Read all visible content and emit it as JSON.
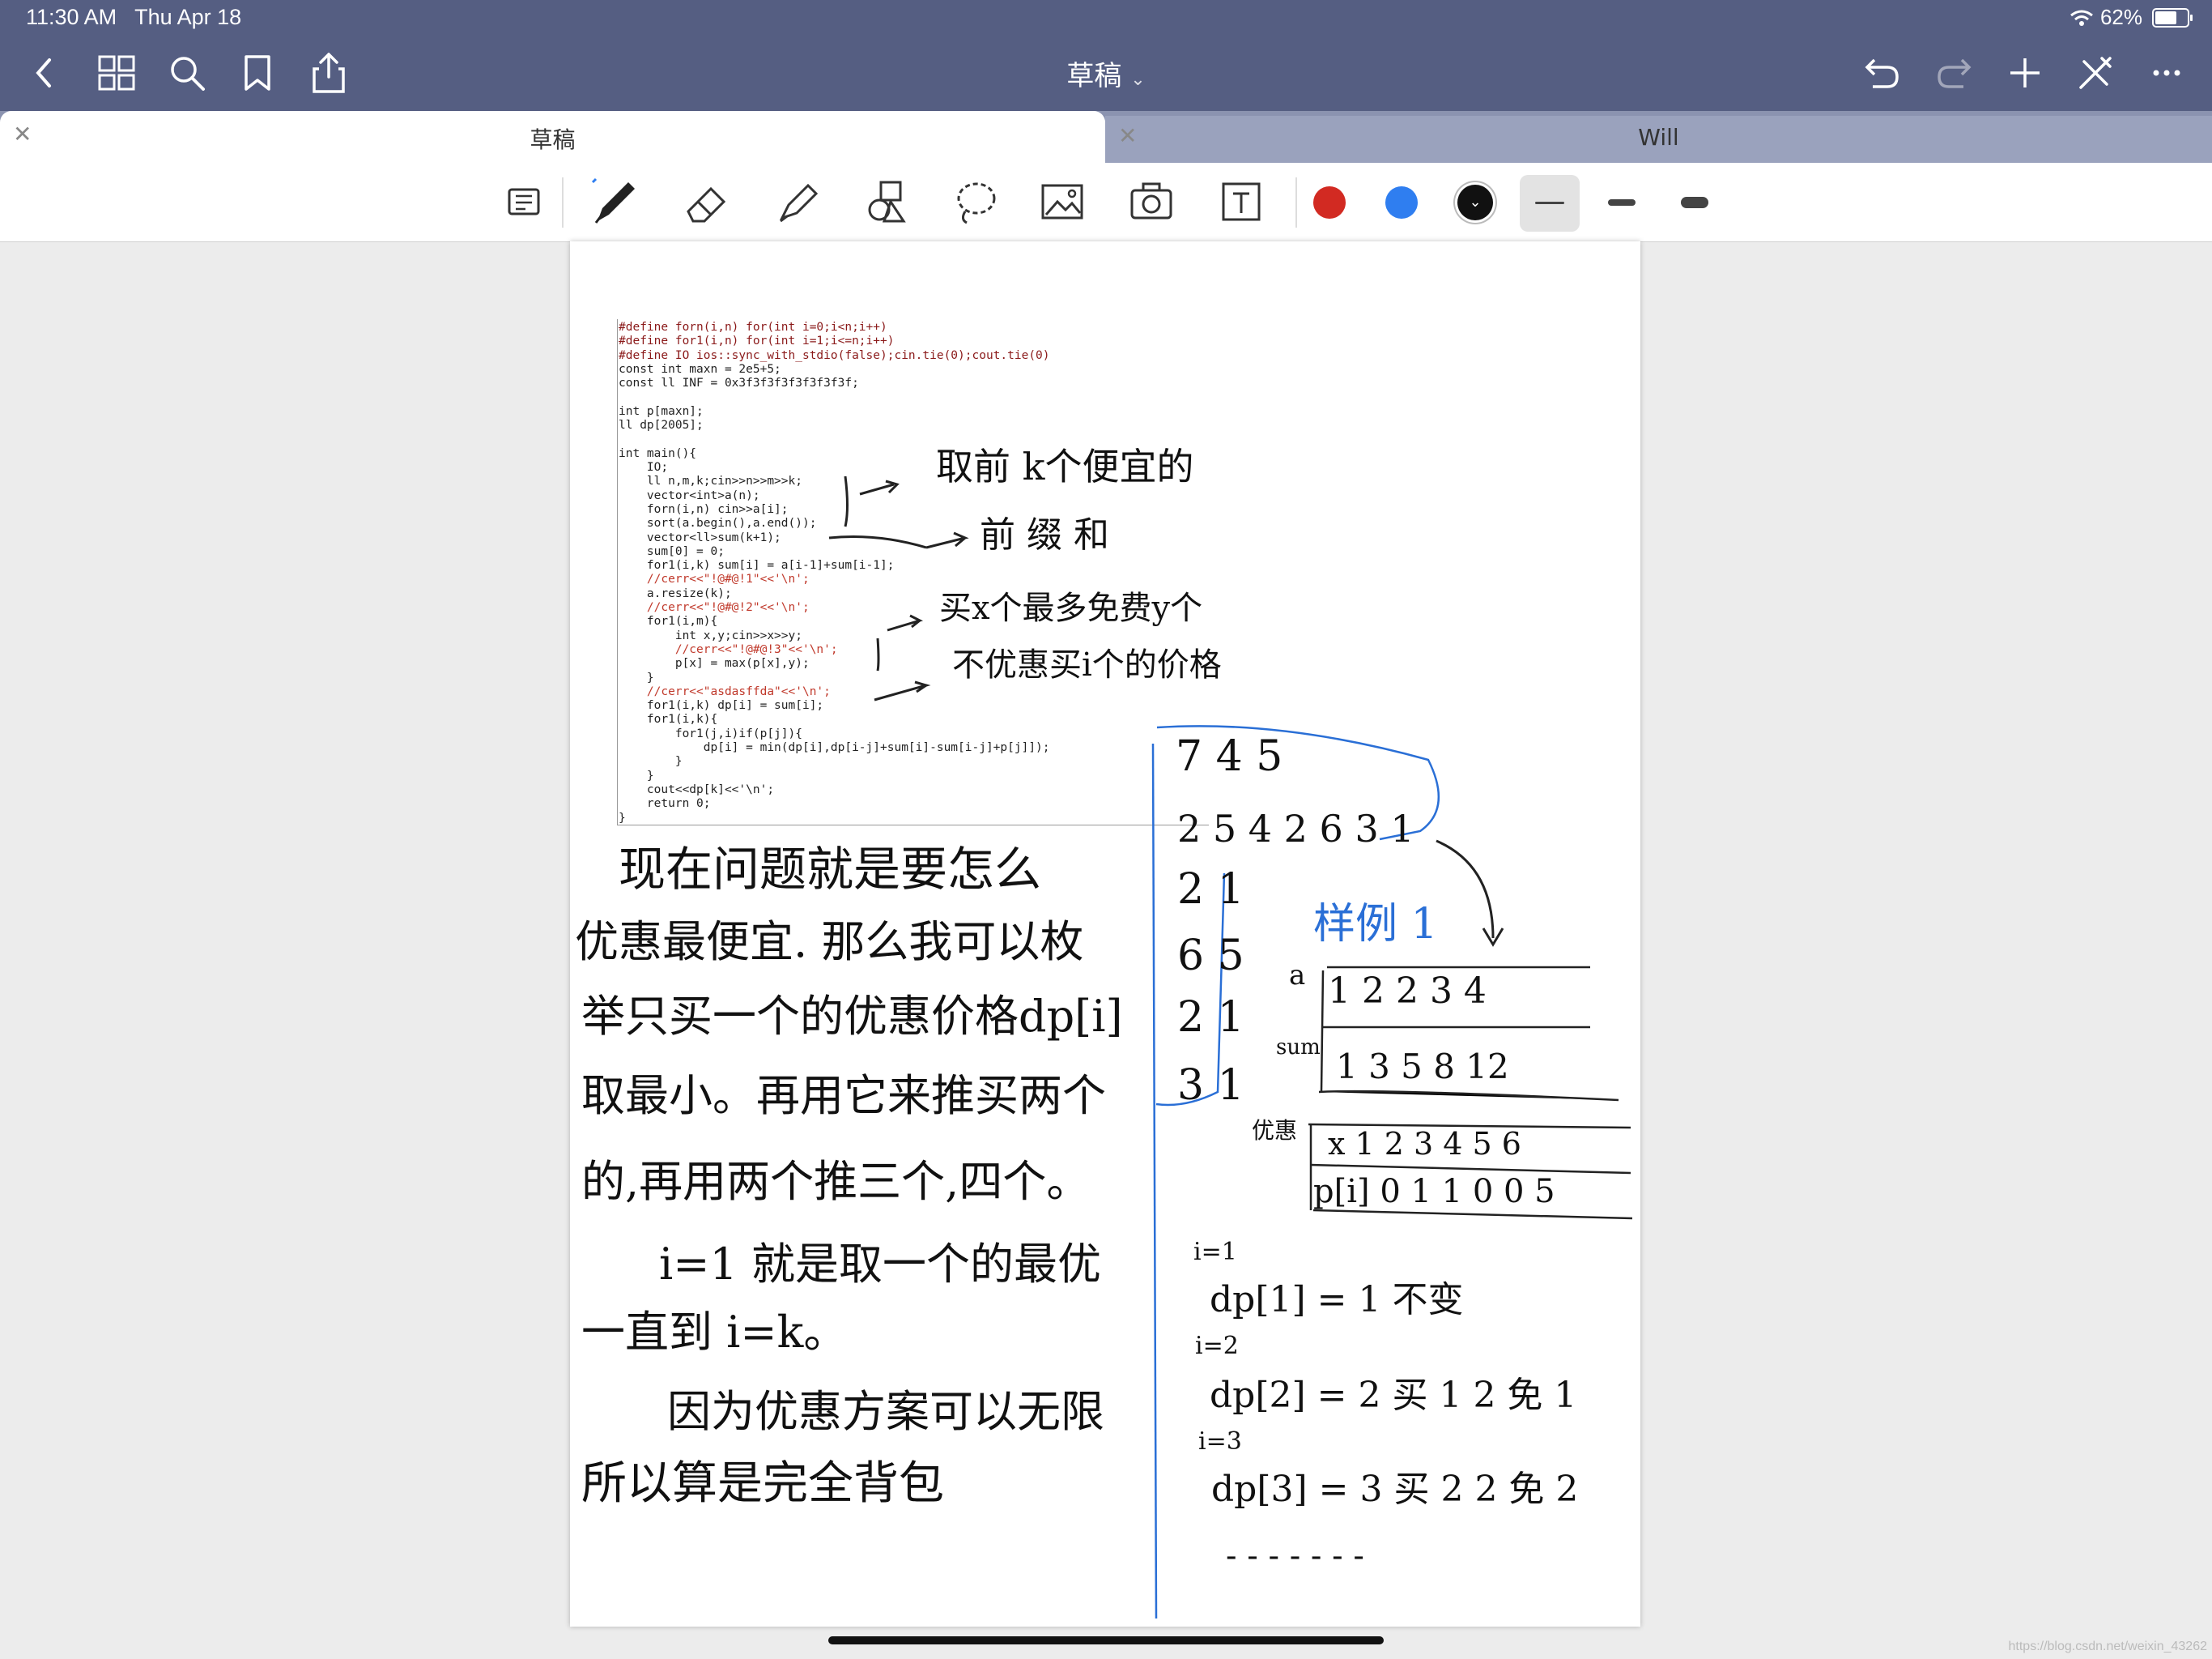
{
  "status": {
    "time": "11:30 AM",
    "date": "Thu Apr 18",
    "battery": "62%"
  },
  "nav": {
    "title": "草稿"
  },
  "tabs": [
    {
      "label": "草稿"
    },
    {
      "label": "Will"
    }
  ],
  "colors": {
    "red": "#d22a22",
    "blue": "#2f7ef0",
    "black": "#111111",
    "bar": "#555e82"
  },
  "code": [
    "#define forn(i,n) for(int i=0;i<n;i++)",
    "#define for1(i,n) for(int i=1;i<=n;i++)",
    "#define IO ios::sync_with_stdio(false);cin.tie(0);cout.tie(0)",
    "const int maxn = 2e5+5;",
    "const ll INF = 0x3f3f3f3f3f3f3f3f;",
    "",
    "int p[maxn];",
    "ll dp[2005];",
    "",
    "int main(){",
    "    IO;",
    "    ll n,m,k;cin>>n>>m>>k;",
    "    vector<int>a(n);",
    "    forn(i,n) cin>>a[i];",
    "    sort(a.begin(),a.end());",
    "    vector<ll>sum(k+1);",
    "    sum[0] = 0;",
    "    for1(i,k) sum[i] = a[i-1]+sum[i-1];",
    "    //cerr<<\"!@#@!1\"<<'\\n';",
    "    a.resize(k);",
    "    //cerr<<\"!@#@!2\"<<'\\n';",
    "    for1(i,m){",
    "        int x,y;cin>>x>>y;",
    "        //cerr<<\"!@#@!3\"<<'\\n';",
    "        p[x] = max(p[x],y);",
    "    }",
    "    //cerr<<\"asdasffda\"<<'\\n';",
    "    for1(i,k) dp[i] = sum[i];",
    "    for1(i,k){",
    "        for1(j,i)if(p[j]){",
    "            dp[i] = min(dp[i],dp[i-j]+sum[i]-sum[i-j]+p[j]]);",
    "        }",
    "    }",
    "    cout<<dp[k]<<'\\n';",
    "    return 0;",
    "}"
  ],
  "notes": {
    "n1": "取前 k个便宜的",
    "n2": "前 缀 和",
    "n3": "买x个最多免费y个",
    "n4": "不优惠买i个的价格",
    "p1": "现在问题就是要怎么",
    "p2": "优惠最便宜. 那么我可以枚",
    "p3": "举只买一个的优惠价格dp[i]",
    "p4": "取最小。再用它来推买两个",
    "p5": "的,再用两个推三个,四个。",
    "p6": "i=1 就是取一个的最优",
    "p7": "一直到 i=k。",
    "p8": "因为优惠方案可以无限",
    "p9": "所以算是完全背包",
    "s1": "7 4 5",
    "s2": "2 5 4 2 6 3 1",
    "s3": "2 1",
    "s4": "6 5",
    "s5": "2 1",
    "s6": "3 1",
    "sample_title": "样例 1",
    "a_label": "a",
    "a_vals": "1  2  2   3  4",
    "sum_label": "sum",
    "sum_vals": "1  3  5  8  12",
    "opt_label": "优惠",
    "x_vals": "x 1   2   3   4   5   6",
    "p_vals": "p[i] 0   1   1   0   0   5",
    "i1": "i=1",
    "dp1": "dp[1] = 1  不变",
    "i2": "i=2",
    "dp2": "dp[2] = 2  买 1 2 免 1",
    "i3": "i=3",
    "dp3": "dp[3] = 3  买 2 2 免 2",
    "dots": "- -   - -   - - -"
  },
  "watermark": "https://blog.csdn.net/weixin_43262"
}
